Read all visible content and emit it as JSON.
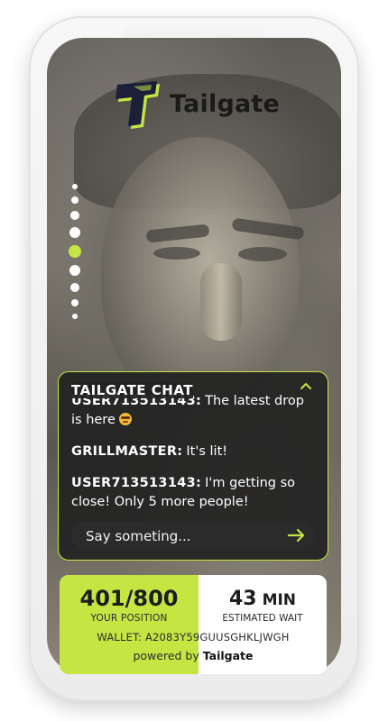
{
  "app": {
    "logo_text": "Tailgate",
    "accent_color": "#c5e543"
  },
  "carousel": {
    "dots_total": 9,
    "active_index": 4
  },
  "chat": {
    "title": "TAILGATE CHAT",
    "toggle_icon": "chevron-up-icon",
    "messages": [
      {
        "user": "USER713513143:",
        "text": "The latest drop is here",
        "emoji": "star-struck-emoji"
      },
      {
        "user": "GRILLMASTER:",
        "text": "It's lit!"
      },
      {
        "user": "USER713513143:",
        "text": "I'm getting so close! Only 5 more people!"
      }
    ],
    "input_placeholder": "Say someting...",
    "send_icon": "arrow-right-icon"
  },
  "queue": {
    "position_value": "401/800",
    "position_label": "YOUR POSITION",
    "wait_number": "43",
    "wait_unit": "MIN",
    "wait_label": "ESTIMATED WAIT",
    "wallet_text": "WALLET: A2083Y59GUUSGHKLJWGH",
    "powered_prefix": "powered by",
    "powered_brand": "Tailgate"
  }
}
